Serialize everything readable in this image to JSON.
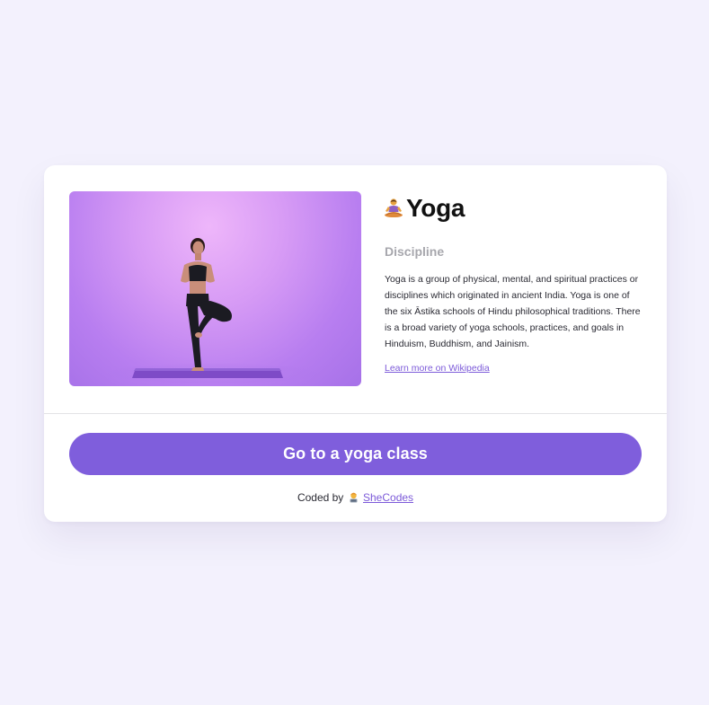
{
  "colors": {
    "page_background": "#f3f1fd",
    "card_background": "#ffffff",
    "accent": "#7f5edc",
    "link": "#7c5ad9",
    "subtitle": "#a7a7ad"
  },
  "card": {
    "image": {
      "icon": "yoga-photo"
    },
    "emoji_icon": "person-in-lotus-position-icon",
    "title": "Yoga",
    "subtitle": "Discipline",
    "description": "Yoga is a group of physical, mental, and spiritual practices or disciplines which originated in ancient India. Yoga is one of the six Āstika schools of Hindu philosophical traditions. There is a broad variety of yoga schools, practices, and goals in Hinduism, Buddhism, and Jainism.",
    "link_label": "Learn more on Wikipedia"
  },
  "cta": {
    "label": "Go to a yoga class"
  },
  "footer": {
    "prefix": "Coded by",
    "emoji_icon": "woman-technologist-icon",
    "link_label": "SheCodes"
  }
}
